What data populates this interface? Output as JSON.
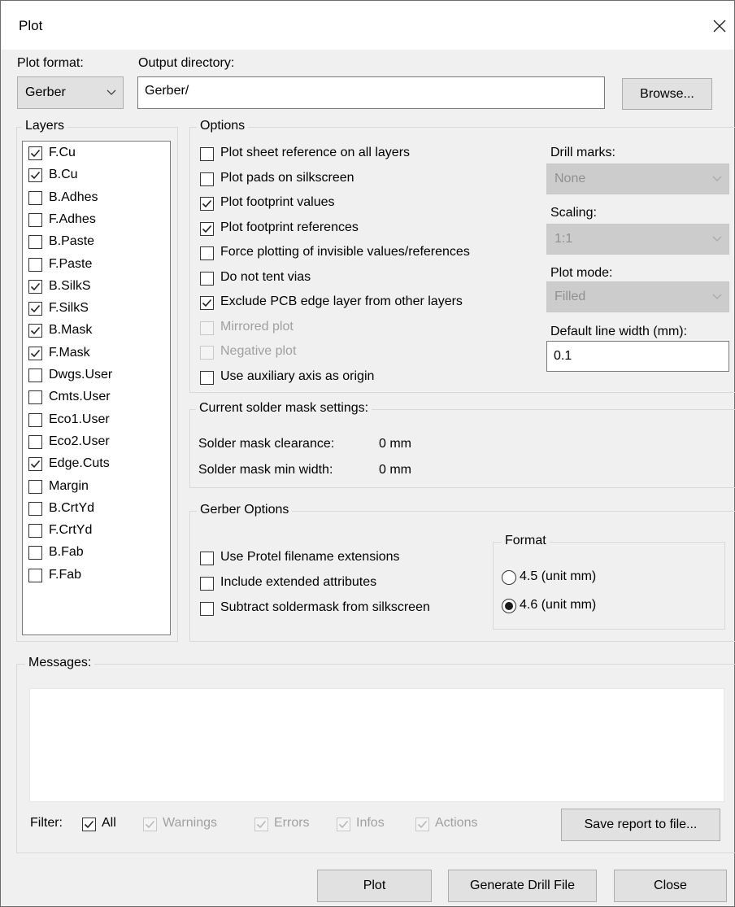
{
  "window": {
    "title": "Plot"
  },
  "header": {
    "plot_format_label": "Plot format:",
    "plot_format_value": "Gerber",
    "output_dir_label": "Output directory:",
    "output_dir_value": "Gerber/",
    "browse_label": "Browse..."
  },
  "layers": {
    "title": "Layers",
    "items": [
      {
        "label": "F.Cu",
        "checked": true
      },
      {
        "label": "B.Cu",
        "checked": true
      },
      {
        "label": "B.Adhes",
        "checked": false
      },
      {
        "label": "F.Adhes",
        "checked": false
      },
      {
        "label": "B.Paste",
        "checked": false
      },
      {
        "label": "F.Paste",
        "checked": false
      },
      {
        "label": "B.SilkS",
        "checked": true
      },
      {
        "label": "F.SilkS",
        "checked": true
      },
      {
        "label": "B.Mask",
        "checked": true
      },
      {
        "label": "F.Mask",
        "checked": true
      },
      {
        "label": "Dwgs.User",
        "checked": false
      },
      {
        "label": "Cmts.User",
        "checked": false
      },
      {
        "label": "Eco1.User",
        "checked": false
      },
      {
        "label": "Eco2.User",
        "checked": false
      },
      {
        "label": "Edge.Cuts",
        "checked": true
      },
      {
        "label": "Margin",
        "checked": false
      },
      {
        "label": "B.CrtYd",
        "checked": false
      },
      {
        "label": "F.CrtYd",
        "checked": false
      },
      {
        "label": "B.Fab",
        "checked": false
      },
      {
        "label": "F.Fab",
        "checked": false
      }
    ]
  },
  "options": {
    "title": "Options",
    "items": [
      {
        "label": "Plot sheet reference on all layers",
        "checked": false,
        "enabled": true
      },
      {
        "label": "Plot pads on silkscreen",
        "checked": false,
        "enabled": true
      },
      {
        "label": "Plot footprint values",
        "checked": true,
        "enabled": true
      },
      {
        "label": "Plot footprint references",
        "checked": true,
        "enabled": true
      },
      {
        "label": "Force plotting of invisible values/references",
        "checked": false,
        "enabled": true
      },
      {
        "label": "Do not tent vias",
        "checked": false,
        "enabled": true
      },
      {
        "label": "Exclude PCB edge layer from other layers",
        "checked": true,
        "enabled": true
      },
      {
        "label": "Mirrored plot",
        "checked": false,
        "enabled": false
      },
      {
        "label": "Negative plot",
        "checked": false,
        "enabled": false
      },
      {
        "label": "Use auxiliary axis as origin",
        "checked": false,
        "enabled": true
      }
    ],
    "drill_marks_label": "Drill marks:",
    "drill_marks_value": "None",
    "scaling_label": "Scaling:",
    "scaling_value": "1:1",
    "plot_mode_label": "Plot mode:",
    "plot_mode_value": "Filled",
    "line_width_label": "Default line width (mm):",
    "line_width_value": "0.1"
  },
  "solder_mask": {
    "title": "Current solder mask settings:",
    "clearance_label": "Solder mask clearance:",
    "clearance_value": "0 mm",
    "min_width_label": "Solder mask min width:",
    "min_width_value": "0 mm"
  },
  "gerber": {
    "title": "Gerber Options",
    "items": [
      {
        "label": "Use Protel filename extensions",
        "checked": false
      },
      {
        "label": "Include extended attributes",
        "checked": false
      },
      {
        "label": "Subtract soldermask from silkscreen",
        "checked": false
      }
    ],
    "format_title": "Format",
    "format_options": [
      {
        "label": "4.5 (unit mm)",
        "selected": false
      },
      {
        "label": "4.6 (unit mm)",
        "selected": true
      }
    ]
  },
  "messages": {
    "title": "Messages:",
    "filter_label": "Filter:",
    "filters": [
      {
        "label": "All",
        "checked": true,
        "enabled": true
      },
      {
        "label": "Warnings",
        "checked": true,
        "enabled": false
      },
      {
        "label": "Errors",
        "checked": true,
        "enabled": false
      },
      {
        "label": "Infos",
        "checked": true,
        "enabled": false
      },
      {
        "label": "Actions",
        "checked": true,
        "enabled": false
      }
    ],
    "save_report_label": "Save report to file..."
  },
  "footer": {
    "plot_label": "Plot",
    "drill_label": "Generate Drill File",
    "close_label": "Close"
  }
}
